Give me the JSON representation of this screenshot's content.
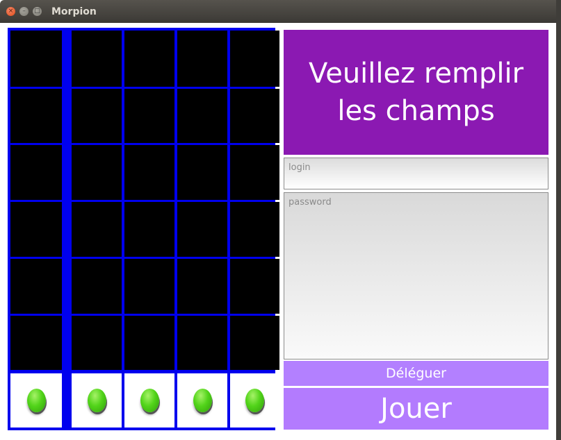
{
  "window": {
    "title": "Morpion",
    "close_glyph": "×",
    "minimize_glyph": "–",
    "maximize_glyph": "□"
  },
  "board": {
    "columns": 5,
    "rows": 6,
    "cell_color": "#000000",
    "border_color": "#0000ee",
    "token_color": "#52d41a",
    "drop_buttons_count": 5
  },
  "panel": {
    "banner_text": "Veuillez remplir les champs",
    "banner_color": "#8b19b2",
    "login_placeholder": "login",
    "password_placeholder": "password",
    "delegate_label": "Déléguer",
    "play_label": "Jouer",
    "button_color": "#b380ff"
  }
}
